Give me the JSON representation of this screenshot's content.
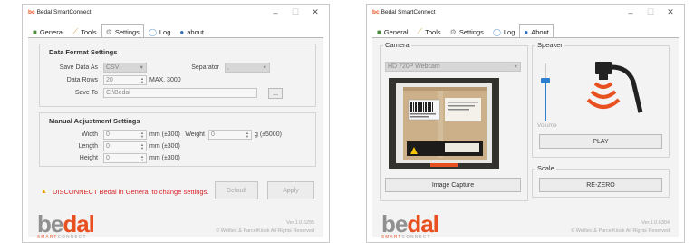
{
  "app": {
    "title": "Bedal SmartConnect",
    "logo": "bc"
  },
  "tabs": {
    "general": "General",
    "tools": "Tools",
    "settings": "Settings",
    "log": "Log",
    "about1": "about",
    "about2": "About"
  },
  "settings": {
    "data_format_title": "Data Format Settings",
    "save_data_as_label": "Save Data As",
    "save_data_as_value": "CSV",
    "separator_label": "Separator",
    "separator_value": ",",
    "data_rows_label": "Data Rows",
    "data_rows_value": "20",
    "data_rows_max": "MAX. 3000",
    "save_to_label": "Save To",
    "save_to_value": "C:\\Bedal",
    "browse_label": "...",
    "manual_title": "Manual Adjustment Settings",
    "width_label": "Width",
    "width_value": "0",
    "width_unit": "mm (±300)",
    "weight_label": "Weight",
    "weight_value": "0",
    "weight_unit": "g (±5000)",
    "length_label": "Length",
    "length_value": "0",
    "length_unit": "mm (±300)",
    "height_label": "Height",
    "height_value": "0",
    "height_unit": "mm (±300)",
    "warning": "DISCONNECT Bedal in General to change settings.",
    "default_label": "Default",
    "apply_label": "Apply"
  },
  "about": {
    "camera_label": "Camera",
    "camera_value": "HD 720P Webcam",
    "speaker_label": "Speaker",
    "volume_label": "Volume",
    "volume_level": 0.72,
    "play_label": "PLAY",
    "scale_label": "Scale",
    "rezero_label": "RE-ZERO",
    "capture_label": "Image Capture"
  },
  "brand": {
    "name_gray": "be",
    "name_orange": "dal",
    "tag_orange": "SMART",
    "tag_gray": "CONNECT"
  },
  "footer1": {
    "version": "Ver.1.0.6295",
    "copyright": "© Welltec & ParcelKiosk All Rights Reserved"
  },
  "footer2": {
    "version": "Ver.1.0.6304",
    "copyright": "© Welltec & ParcelKiosk All Rights Reserved"
  },
  "colors": {
    "accent": "#e8501f",
    "warning": "#d9262b",
    "slider": "#2f7fd0"
  }
}
